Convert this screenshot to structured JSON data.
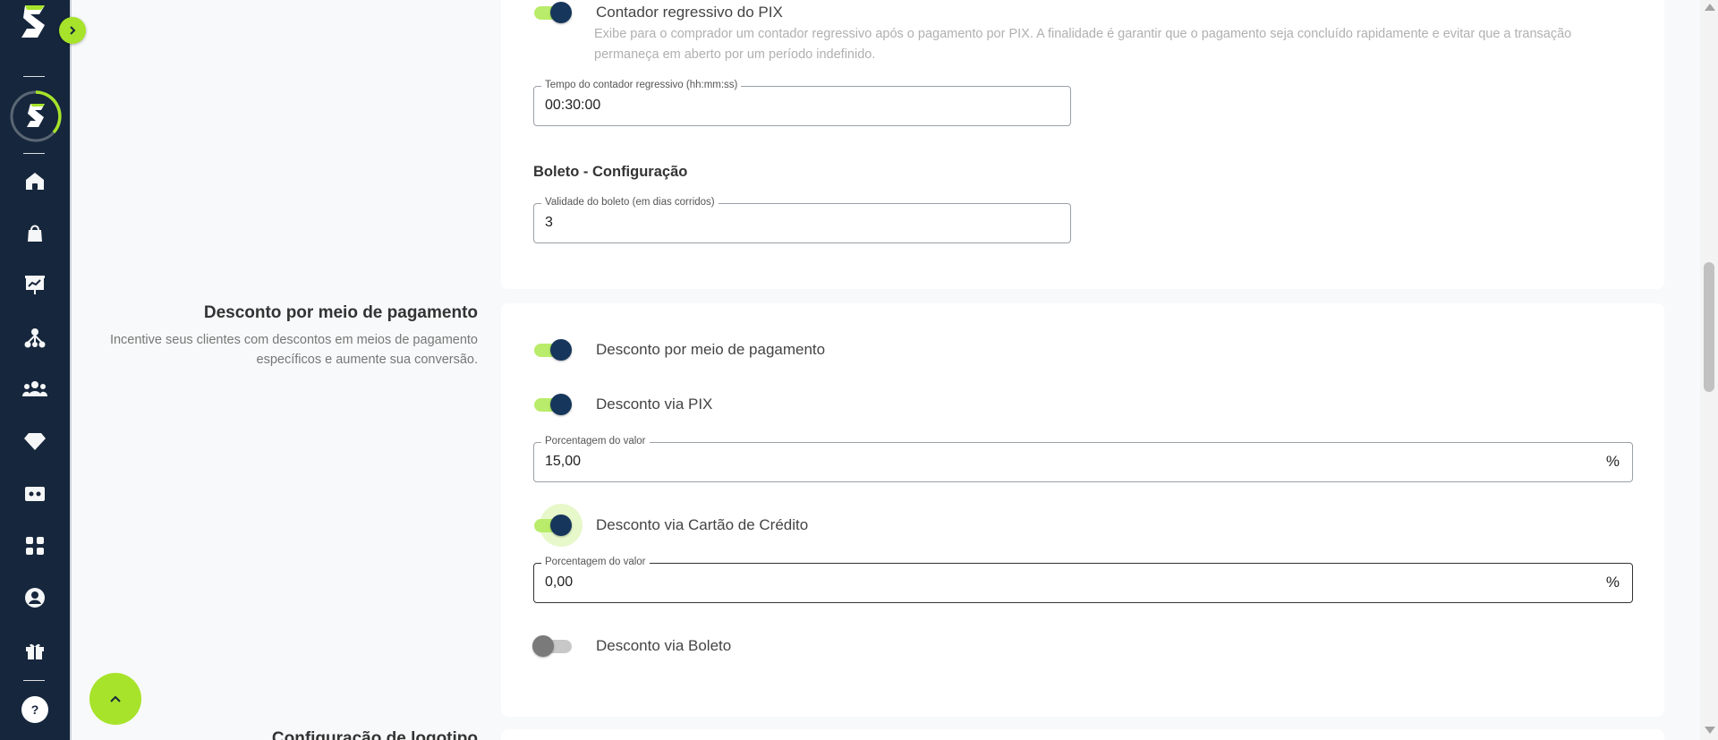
{
  "colors": {
    "sidebar": "#16263c",
    "accent": "#a6e32a",
    "toggle_thumb": "#16365c",
    "toggle_track_on": "#b9ec6a"
  },
  "sidebar": {
    "items": [
      {
        "icon": "home-icon"
      },
      {
        "icon": "shopping-bag-icon"
      },
      {
        "icon": "presentation-chart-icon"
      },
      {
        "icon": "network-icon"
      },
      {
        "icon": "users-icon"
      },
      {
        "icon": "diamond-icon"
      },
      {
        "icon": "ticket-icon"
      },
      {
        "icon": "apps-grid-icon"
      },
      {
        "icon": "user-circle-icon"
      },
      {
        "icon": "gift-icon"
      }
    ],
    "help_label": "?"
  },
  "pix": {
    "countdown_toggle_label": "Contador regressivo do PIX",
    "countdown_toggle_on": true,
    "countdown_help_line1": "Exibe para o comprador um contador regressivo após o pagamento por PIX. A finalidade é garantir que o pagamento seja concluído rapidamente e evitar que a transação",
    "countdown_help_line2": "permaneça em aberto por um período indefinido.",
    "countdown_field_label": "Tempo do contador regressivo (hh:mm:ss)",
    "countdown_field_value": "00:30:00"
  },
  "boleto": {
    "heading": "Boleto - Configuração",
    "validity_field_label": "Validade do boleto (em dias corridos)",
    "validity_field_value": "3"
  },
  "discount_section": {
    "title": "Desconto por meio de pagamento",
    "description": "Incentive seus clientes com descontos em meios de pagamento específicos e aumente sua conversão.",
    "toggles": {
      "main_label": "Desconto por meio de pagamento",
      "main_on": true,
      "pix_label": "Desconto via PIX",
      "pix_on": true,
      "card_label": "Desconto via Cartão de Crédito",
      "card_on": true,
      "boleto_label": "Desconto via Boleto",
      "boleto_on": false
    },
    "pix_field_label": "Porcentagem do valor",
    "pix_field_value": "15,00",
    "card_field_label": "Porcentagem do valor",
    "card_field_value": "0,00",
    "percent_suffix": "%"
  },
  "next_section": {
    "title": "Configuração de logotipo"
  }
}
